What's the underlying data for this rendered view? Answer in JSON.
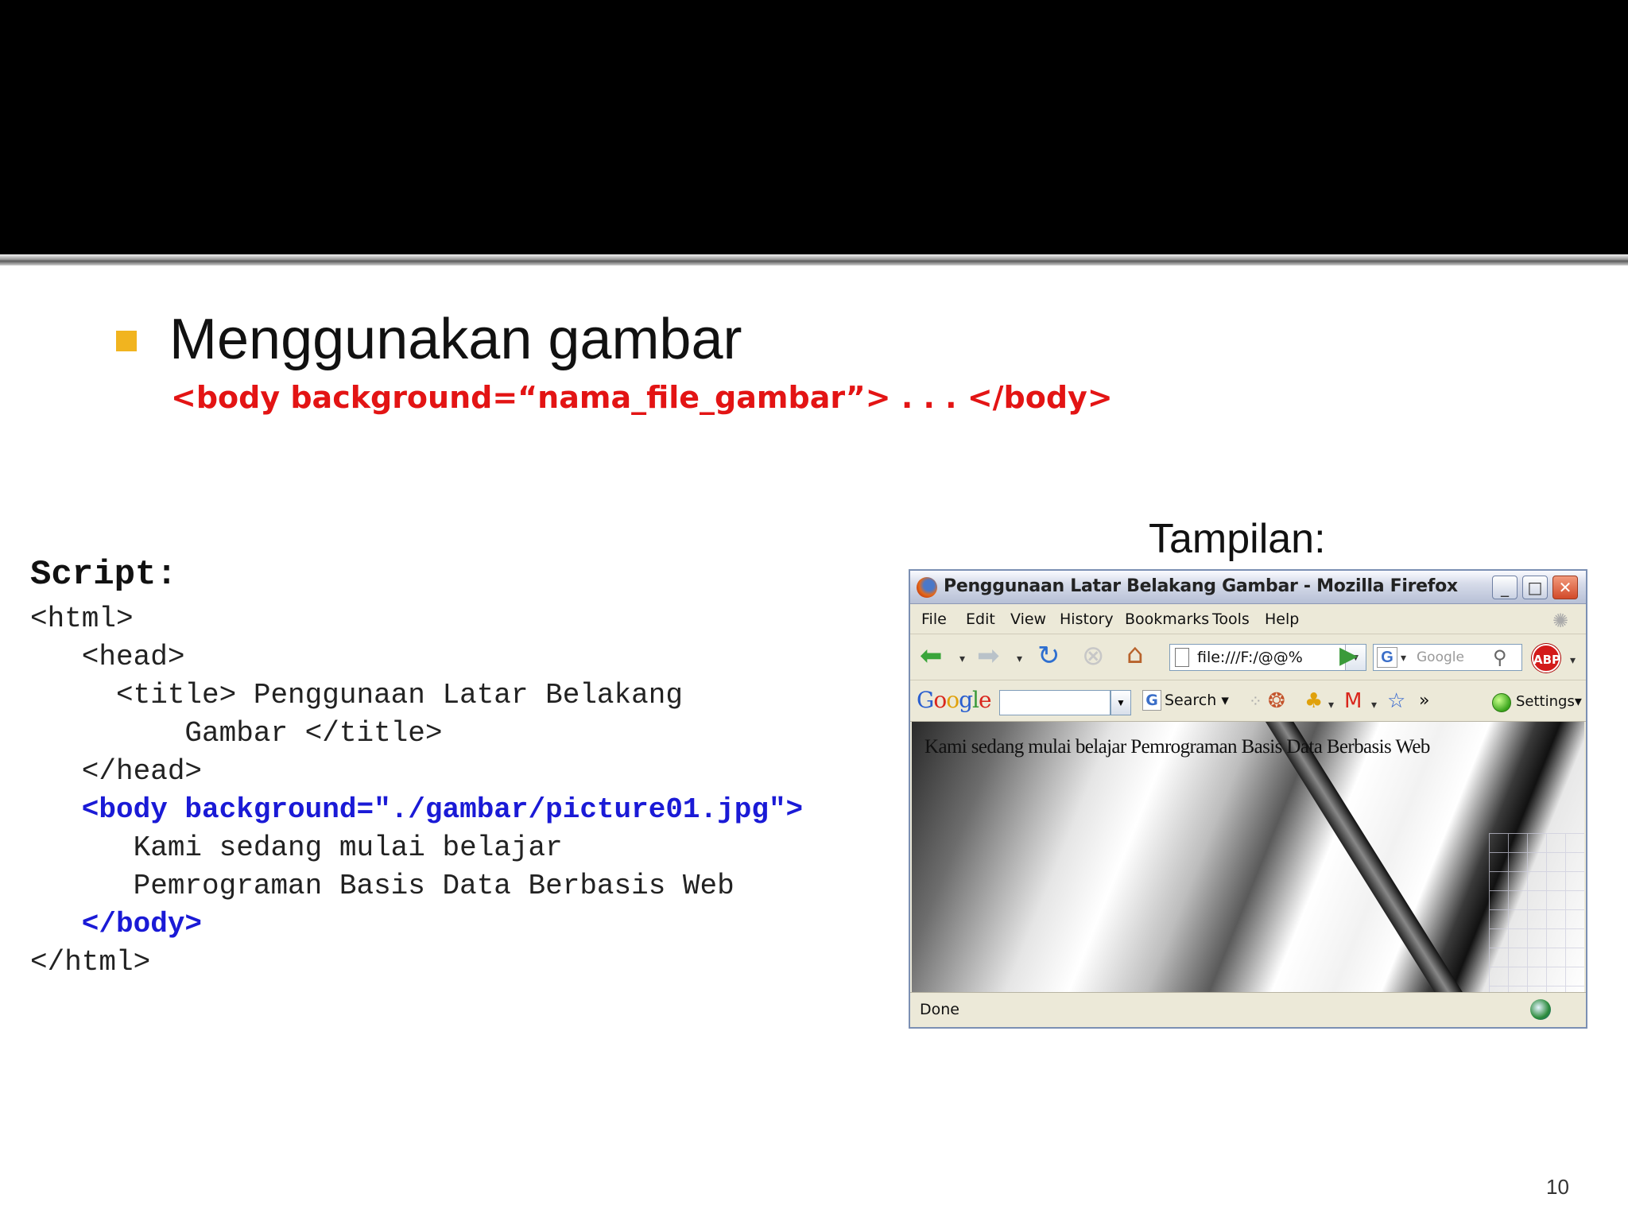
{
  "slide": {
    "bullet": "Menggunakan gambar",
    "syntax": "<body background=“nama_file_gambar”> . . . </body>",
    "tampilan_label": "Tampilan:",
    "page_number": "10"
  },
  "code": {
    "heading": "Script:",
    "lines": [
      "<html>",
      "   <head>",
      "     <title> Penggunaan Latar Belakang",
      "         Gambar </title>",
      "   </head>",
      "   <body background=\"./gambar/picture01.jpg\">",
      "      Kami sedang mulai belajar",
      "      Pemrograman Basis Data Berbasis Web",
      "   </body>",
      "</html>"
    ]
  },
  "browser": {
    "title": "Penggunaan Latar Belakang Gambar - Mozilla Firefox",
    "window_buttons": {
      "minimize": "_",
      "maximize": "□",
      "close": "✕"
    },
    "menu": [
      "File",
      "Edit",
      "View",
      "History",
      "Bookmarks",
      "Tools",
      "Help"
    ],
    "url": "file:///F:/@@%",
    "search_placeholder": "Google",
    "abp_label": "ABP",
    "google_toolbar": {
      "search_label": "Search",
      "settings_label": "Settings▾",
      "more": "»"
    },
    "page_text": "Kami sedang mulai belajar Pemrograman Basis Data Berbasis Web",
    "status": "Done"
  },
  "colors": {
    "title_bar": "#000000",
    "bullet": "#f1b41f",
    "syntax": "#e31414",
    "code_highlight": "#1a1ad6"
  },
  "icons": {
    "back": "back-arrow-icon",
    "forward": "forward-arrow-icon",
    "reload": "reload-icon",
    "stop": "stop-icon",
    "home": "home-icon",
    "go": "go-arrow-icon",
    "search": "magnifier-icon"
  }
}
